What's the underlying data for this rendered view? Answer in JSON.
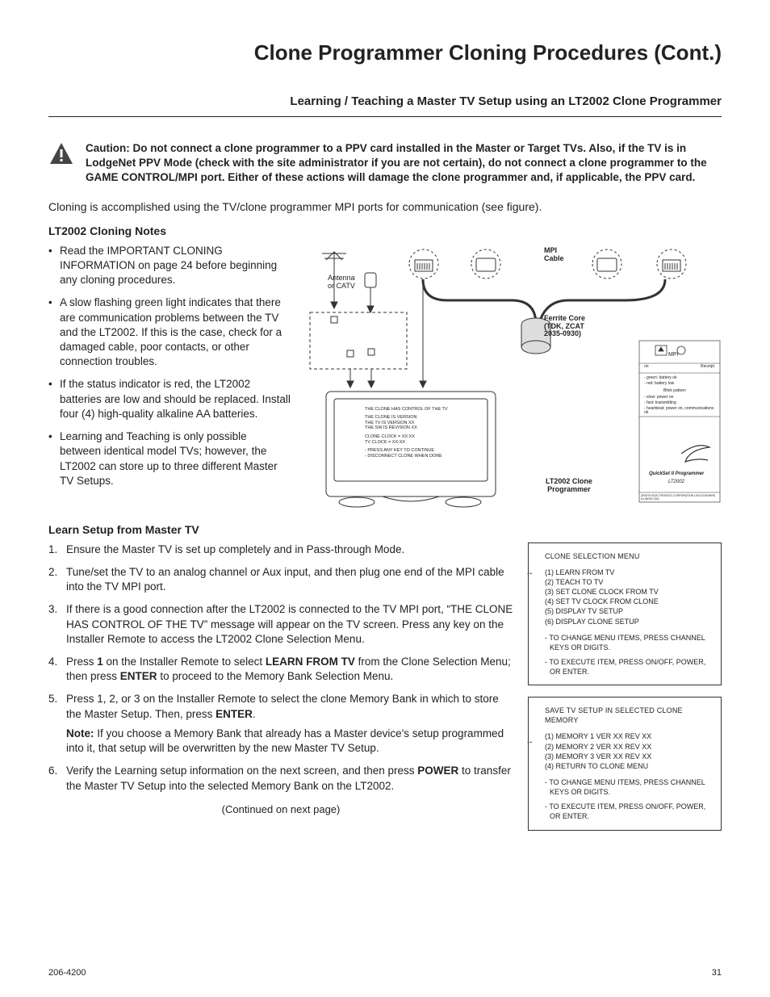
{
  "page_title": "Clone Programmer Cloning Procedures (Cont.)",
  "subtitle": "Learning / Teaching a Master TV Setup using an LT2002 Clone Programmer",
  "caution": "Caution: Do not connect a clone programmer to a PPV card installed in the Master or Target TVs. Also, if the TV is in LodgeNet PPV Mode (check with the site administrator if you are not certain), do not connect a clone programmer to the GAME CONTROL/MPI port. Either of these actions will damage the clone programmer and, if applicable, the PPV card.",
  "intro": "Cloning is accomplished using the TV/clone programmer MPI ports for communication (see figure).",
  "notes_heading": "LT2002 Cloning Notes",
  "notes": [
    "Read the IMPORTANT CLONING INFORMATION on page 24 before beginning any cloning procedures.",
    "A slow flashing green light indicates that there are communication problems between the TV and the LT2002. If this is the case, check for a damaged cable, poor contacts, or other connection troubles.",
    "If the status indicator is red, the LT2002 batteries are low and should be replaced. Install four (4) high-quality alkaline AA batteries.",
    "Learning and Teaching is only possible between identical model TVs; however, the LT2002 can store up to three different Master TV Setups."
  ],
  "figure": {
    "antenna": "Antenna\nor CATV",
    "mpi_cable": "MPI\nCable",
    "ferrite": "Ferrite Core\n(TDK, ZCAT\n2035-0930)",
    "lt2002": "LT2002 Clone\nProgrammer",
    "mpi": "MPI",
    "quickset": "QuickSet II Programmer",
    "quickset_model": "LT2002",
    "zenith_line": "ZENITH ELECTRONICS CORPORATION LINCOLNSHIRE, ILLINOIS USA",
    "tv_screen": {
      "l1": "THE CLONE HAS CONTROL OF THE TV",
      "l2": "THE CLONE IS VERSION",
      "l3": "THE TV IS VERSION     XX",
      "l4": "THE SW IS REVISION    XX",
      "l5": "CLONE CLOCK  =  XX:XX",
      "l6": "TV        CLOCK  =  XX:XX",
      "l7": "- PRESS ANY KEY TO CONTINUE",
      "l8": "- DISCONNECT CLONE WHEN DONE"
    },
    "prog_labels": {
      "a": "on",
      "b": "Receipt",
      "c": "- green:  battery ok",
      "d": "- red:     battery low",
      "e": "Blink pattern",
      "f": "- slow:    power on",
      "g": "- fast:     transmitting",
      "h": "- heartbeat: power on, communications ok"
    }
  },
  "learn_heading": "Learn Setup from Master TV",
  "steps": {
    "s1": "Ensure the Master TV is set up completely and in Pass-through Mode.",
    "s2": "Tune/set the TV to an analog channel or Aux input, and then plug one end of the MPI cable into the TV MPI port.",
    "s3": "If there is a good connection after the LT2002 is connected to the TV MPI port, “THE CLONE HAS CONTROL OF THE TV” message will appear on the TV screen. Press any key on the Installer Remote to access the LT2002 Clone Selection Menu.",
    "s4_pre": "Press ",
    "s4_b1": "1",
    "s4_mid1": " on the Installer Remote to select ",
    "s4_b2": "LEARN FROM TV",
    "s4_mid2": " from the Clone Selection Menu; then press ",
    "s4_b3": "ENTER",
    "s4_post": " to proceed to the Memory Bank Selection Menu.",
    "s5_pre": "Press 1, 2, or 3 on the Installer Remote to select the clone Memory Bank in which to store the Master Setup. Then, press ",
    "s5_b1": "ENTER",
    "s5_post": ".",
    "s5_note_b": "Note:",
    "s5_note": " If you choose a Memory Bank that already has a Master device's setup programmed into it, that setup will be overwritten by the new Master TV Setup.",
    "s6_pre": "Verify the Learning setup information on the next screen, and then press ",
    "s6_b1": "POWER",
    "s6_post": " to transfer the Master TV Setup into the selected Memory Bank on the LT2002."
  },
  "menu1": {
    "title": "CLONE SELECTION MENU",
    "items": [
      "(1)  LEARN FROM TV",
      "(2)  TEACH TO TV",
      "(3)  SET CLONE CLOCK FROM TV",
      "(4)  SET TV CLOCK FROM CLONE",
      "(5)  DISPLAY TV SETUP",
      "(6)  DISPLAY CLONE SETUP"
    ],
    "hint1": "- TO CHANGE MENU ITEMS, PRESS CHANNEL KEYS OR DIGITS.",
    "hint2": "- TO EXECUTE ITEM, PRESS ON/OFF, POWER, OR ENTER."
  },
  "menu2": {
    "title": "SAVE TV SETUP IN SELECTED CLONE MEMORY",
    "items": [
      "(1)  MEMORY 1  VER XX  REV XX",
      "(2)  MEMORY 2  VER XX  REV XX",
      "(3)  MEMORY 3  VER XX  REV XX",
      "(4)  RETURN TO CLONE MENU"
    ],
    "hint1": "- TO CHANGE MENU ITEMS, PRESS CHANNEL KEYS OR DIGITS.",
    "hint2": "- TO EXECUTE ITEM, PRESS ON/OFF, POWER, OR ENTER."
  },
  "continued": "(Continued on next page)",
  "footer_left": "206-4200",
  "footer_right": "31"
}
